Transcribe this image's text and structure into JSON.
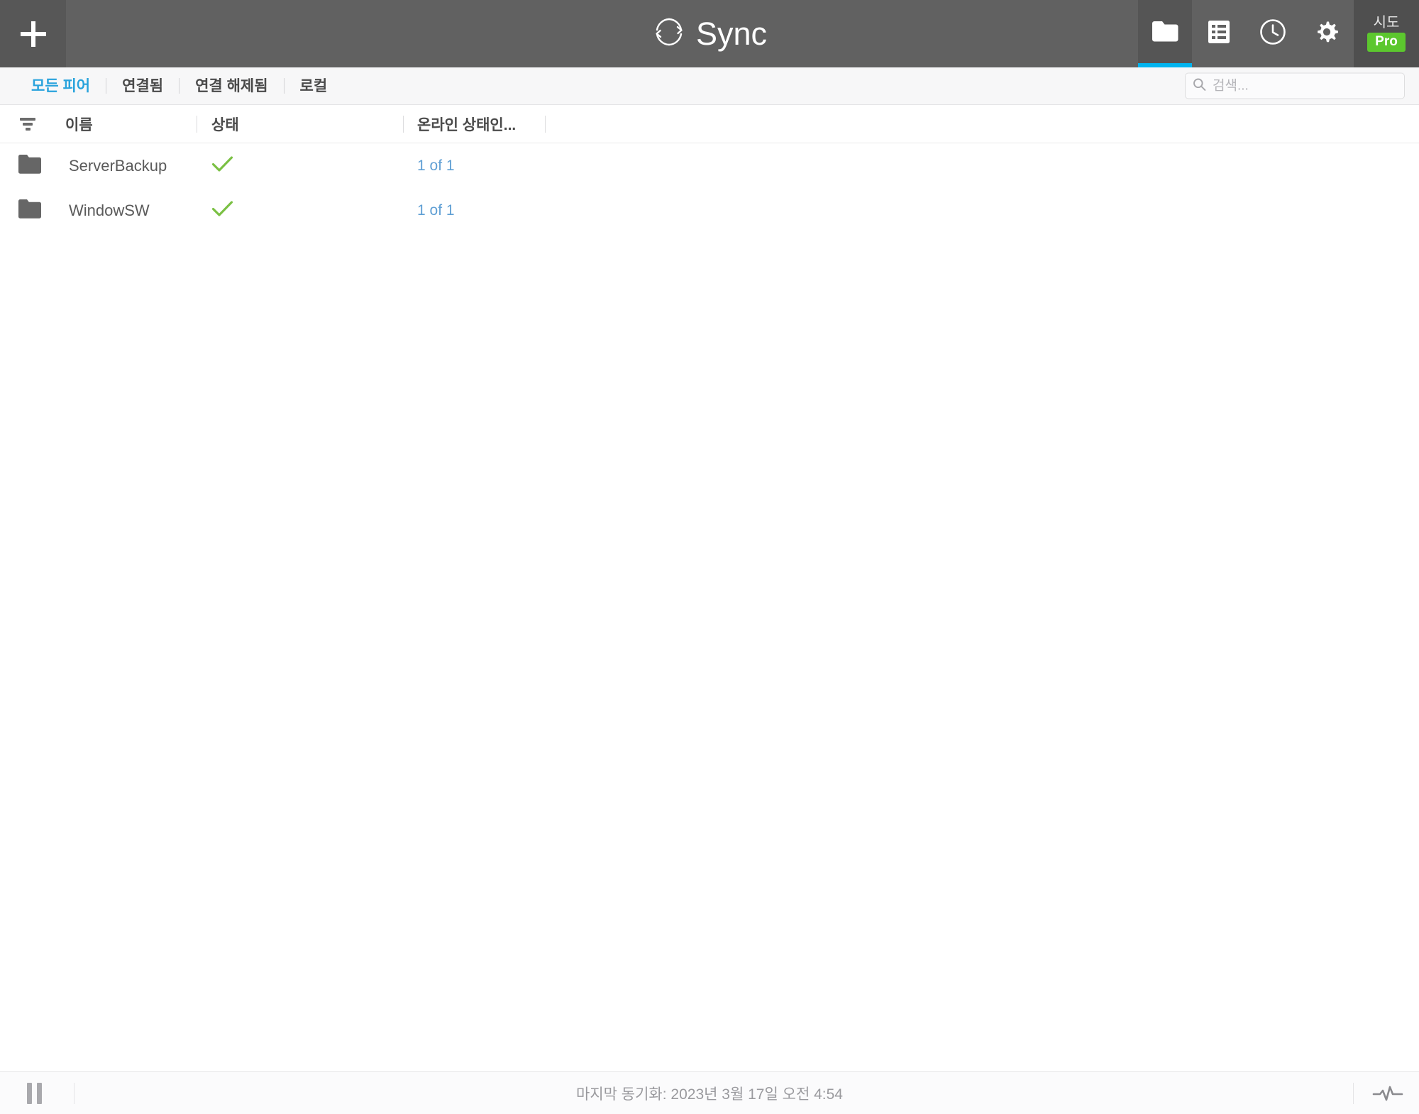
{
  "app": {
    "title": "Sync",
    "logo_icon": "sync-circular-arrows-icon"
  },
  "header": {
    "add_button_icon": "plus-icon",
    "nav_tabs": [
      {
        "icon": "folder-icon",
        "name": "folders",
        "active": true
      },
      {
        "icon": "document-list-icon",
        "name": "transfers",
        "active": false
      },
      {
        "icon": "clock-icon",
        "name": "history",
        "active": false
      },
      {
        "icon": "gear-icon",
        "name": "settings",
        "active": false
      }
    ],
    "account": {
      "name": "시도",
      "badge": "Pro"
    }
  },
  "filterbar": {
    "filters": [
      {
        "label": "모든 피어",
        "active": true
      },
      {
        "label": "연결됨",
        "active": false
      },
      {
        "label": "연결 해제됨",
        "active": false
      },
      {
        "label": "로컬",
        "active": false
      }
    ],
    "search": {
      "placeholder": "검색...",
      "value": "",
      "icon": "search-icon"
    }
  },
  "table": {
    "filter_icon": "filter-icon",
    "columns": {
      "name": "이름",
      "status": "상태",
      "online": "온라인 상태인..."
    },
    "rows": [
      {
        "icon": "folder-icon",
        "name": "ServerBackup",
        "status_icon": "check-icon",
        "online": "1 of 1"
      },
      {
        "icon": "folder-icon",
        "name": "WindowSW",
        "status_icon": "check-icon",
        "online": "1 of 1"
      }
    ]
  },
  "statusbar": {
    "pause_icon": "pause-icon",
    "sync_text": "마지막 동기화: 2023년 3월 17일 오전 4:54",
    "activity_icon": "activity-pulse-icon"
  },
  "colors": {
    "header_bg": "#616161",
    "accent_cyan": "#00b4ef",
    "link_blue": "#5f9fd4",
    "active_tab_blue": "#29a3dc",
    "check_green": "#7ac043",
    "pro_green": "#5cc72e"
  }
}
